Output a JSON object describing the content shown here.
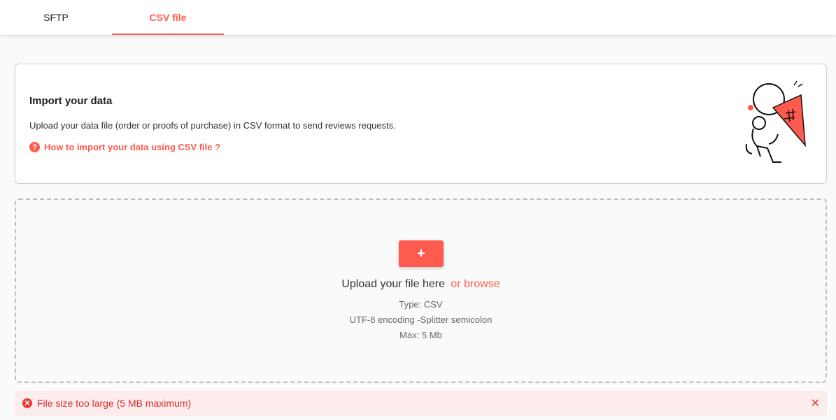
{
  "tabs": [
    {
      "label": "SFTP",
      "active": false
    },
    {
      "label": "CSV file",
      "active": true
    }
  ],
  "info": {
    "title": "Import your data",
    "description": "Upload your data file (order or proofs of purchase) in CSV format to send reviews requests.",
    "help_icon": "?",
    "help_link": "How to import your data using CSV file ?"
  },
  "dropzone": {
    "add_button": "+",
    "upload_text": "Upload your file here",
    "browse_text": "or browse",
    "type": "Type: CSV",
    "encoding": "UTF-8 encoding -Splitter semicolon",
    "max": "Max: 5 Mb"
  },
  "error": {
    "icon": "✕",
    "message": "File size too large (5 MB maximum)",
    "close": "✕"
  },
  "colors": {
    "accent": "#ff5a4e",
    "error_bg": "#fdecec",
    "error_text": "#d32f2f"
  }
}
